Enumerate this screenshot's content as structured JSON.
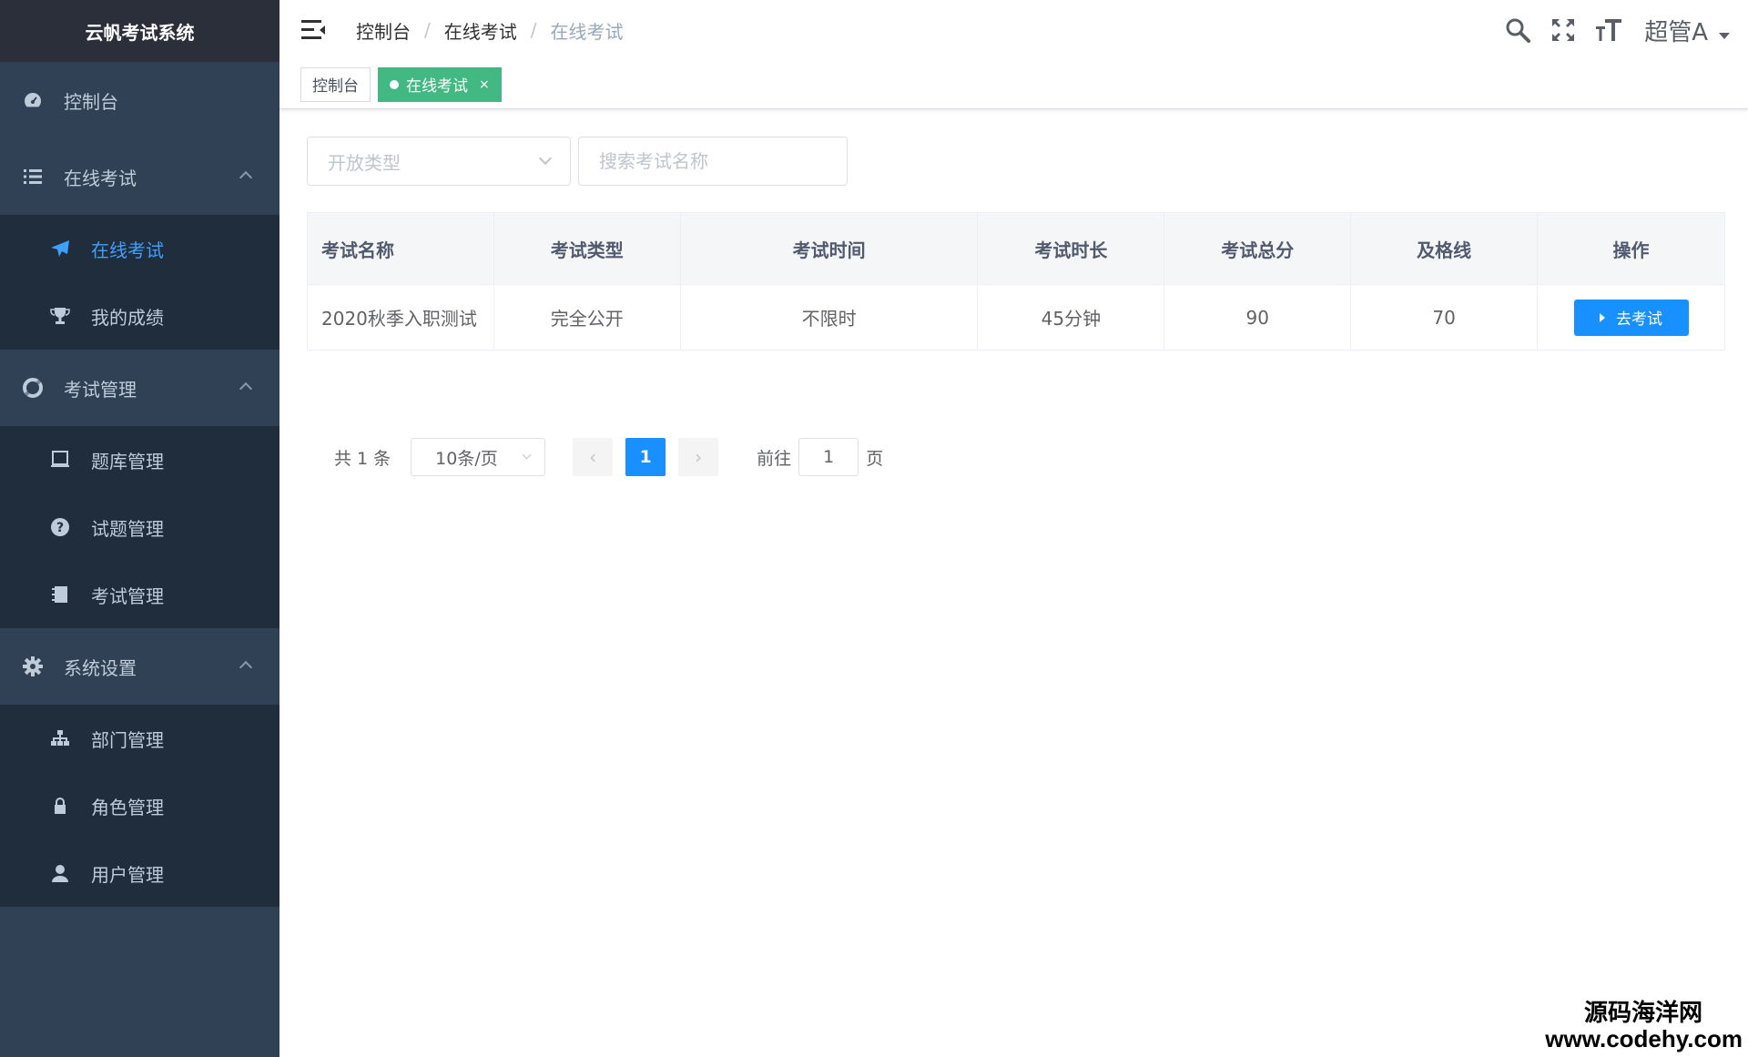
{
  "app": {
    "title": "云帆考试系统"
  },
  "sidebar": {
    "groups": [
      {
        "label": "控制台",
        "icon": "dashboard-icon",
        "items": []
      },
      {
        "label": "在线考试",
        "icon": "list-icon",
        "items": [
          {
            "label": "在线考试",
            "icon": "paper-plane-icon",
            "active": true
          },
          {
            "label": "我的成绩",
            "icon": "trophy-icon"
          }
        ]
      },
      {
        "label": "考试管理",
        "icon": "life-ring-icon",
        "items": [
          {
            "label": "题库管理",
            "icon": "book-icon"
          },
          {
            "label": "试题管理",
            "icon": "question-icon"
          },
          {
            "label": "考试管理",
            "icon": "notebook-icon"
          }
        ]
      },
      {
        "label": "系统设置",
        "icon": "gear-icon",
        "items": [
          {
            "label": "部门管理",
            "icon": "sitemap-icon"
          },
          {
            "label": "角色管理",
            "icon": "lock-icon"
          },
          {
            "label": "用户管理",
            "icon": "user-icon"
          }
        ]
      }
    ]
  },
  "header": {
    "breadcrumb": [
      "控制台",
      "在线考试",
      "在线考试"
    ],
    "separator": "/",
    "username": "超管A"
  },
  "tags": [
    {
      "label": "控制台",
      "active": false
    },
    {
      "label": "在线考试",
      "active": true,
      "close": "×"
    }
  ],
  "filters": {
    "type_placeholder": "开放类型",
    "search_placeholder": "搜索考试名称"
  },
  "table": {
    "columns": [
      "考试名称",
      "考试类型",
      "考试时间",
      "考试总分",
      "及格线",
      "操作",
      "考试时长"
    ],
    "headers": [
      "考试名称",
      "考试类型",
      "考试时间",
      "考试时长",
      "考试总分",
      "及格线",
      "操作"
    ],
    "rows": [
      {
        "name": "2020秋季入职测试",
        "type": "完全公开",
        "time": "不限时",
        "duration": "45分钟",
        "total": "90",
        "pass": "70",
        "action": "去考试"
      }
    ]
  },
  "pagination": {
    "total_text": "共 1 条",
    "page_size": "10条/页",
    "prev": "‹",
    "current_page": "1",
    "next": "›",
    "goto_label": "前往",
    "goto_value": "1",
    "page_suffix": "页"
  },
  "watermark": {
    "line1": "源码海洋网",
    "line2": "www.codehy.com"
  },
  "colors": {
    "sidebar_bg": "#304156",
    "submenu_bg": "#1f2d3d",
    "active_tag": "#42b983",
    "primary": "#1890ff",
    "active_menu_text": "#409eff"
  }
}
